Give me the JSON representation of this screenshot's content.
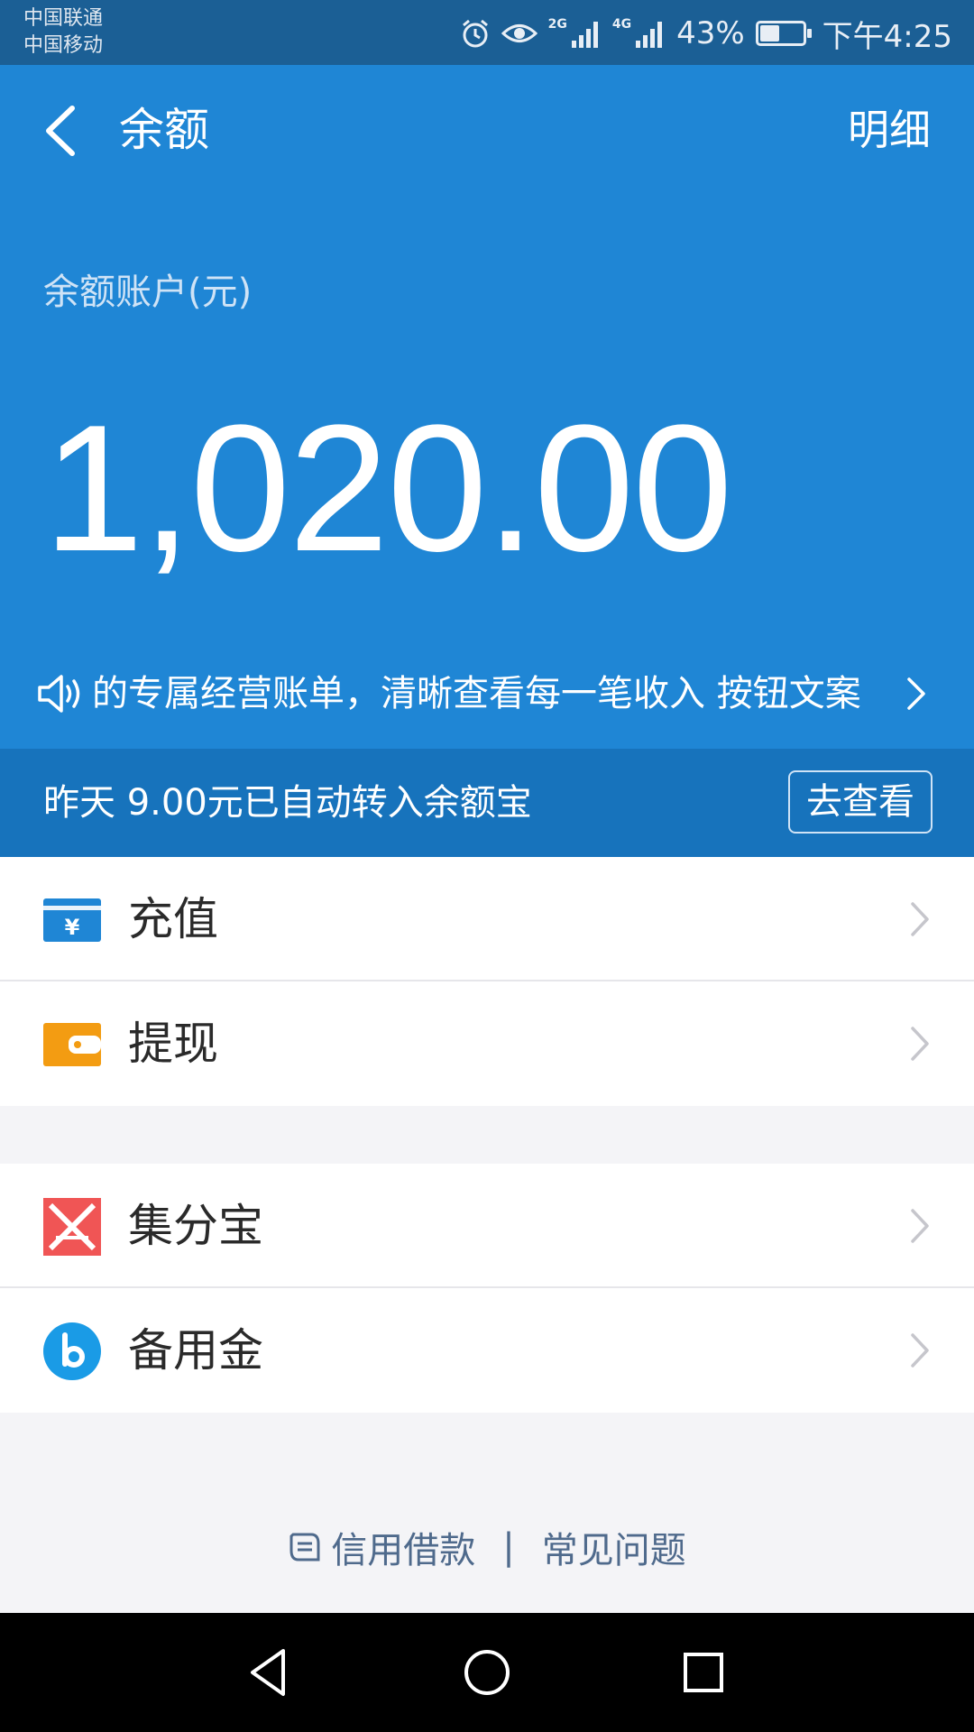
{
  "status_bar": {
    "carrier_1": "中国联通",
    "carrier_2": "中国移动",
    "net_1": "2G",
    "net_2": "4G",
    "battery": "43%",
    "time": "下午4:25"
  },
  "header": {
    "title": "余额",
    "detail_link": "明细",
    "account_label": "余额账户(元)",
    "balance": "1,020.00",
    "notice_text": "的专属经营账单，清晰查看每一笔收入 按钮文案"
  },
  "banner": {
    "text": "昨天 9.00元已自动转入余额宝",
    "button": "去查看"
  },
  "menu_group_1": [
    {
      "label": "充值",
      "icon": "yen-card-icon"
    },
    {
      "label": "提现",
      "icon": "wallet-icon"
    }
  ],
  "menu_group_2": [
    {
      "label": "集分宝",
      "icon": "jifenbao-icon"
    },
    {
      "label": "备用金",
      "icon": "beiyongjin-icon"
    }
  ],
  "footer": {
    "credit_loan": "信用借款",
    "separator": "|",
    "faq": "常见问题"
  },
  "colors": {
    "header_blue": "#1f86d5",
    "banner_blue": "#1773bc",
    "status_bar": "#1b5f95",
    "recharge_icon": "#1f86d5",
    "withdraw_icon": "#f39c12",
    "jifenbao_icon": "#f05555",
    "beiyongjin_icon": "#1a9be6"
  }
}
